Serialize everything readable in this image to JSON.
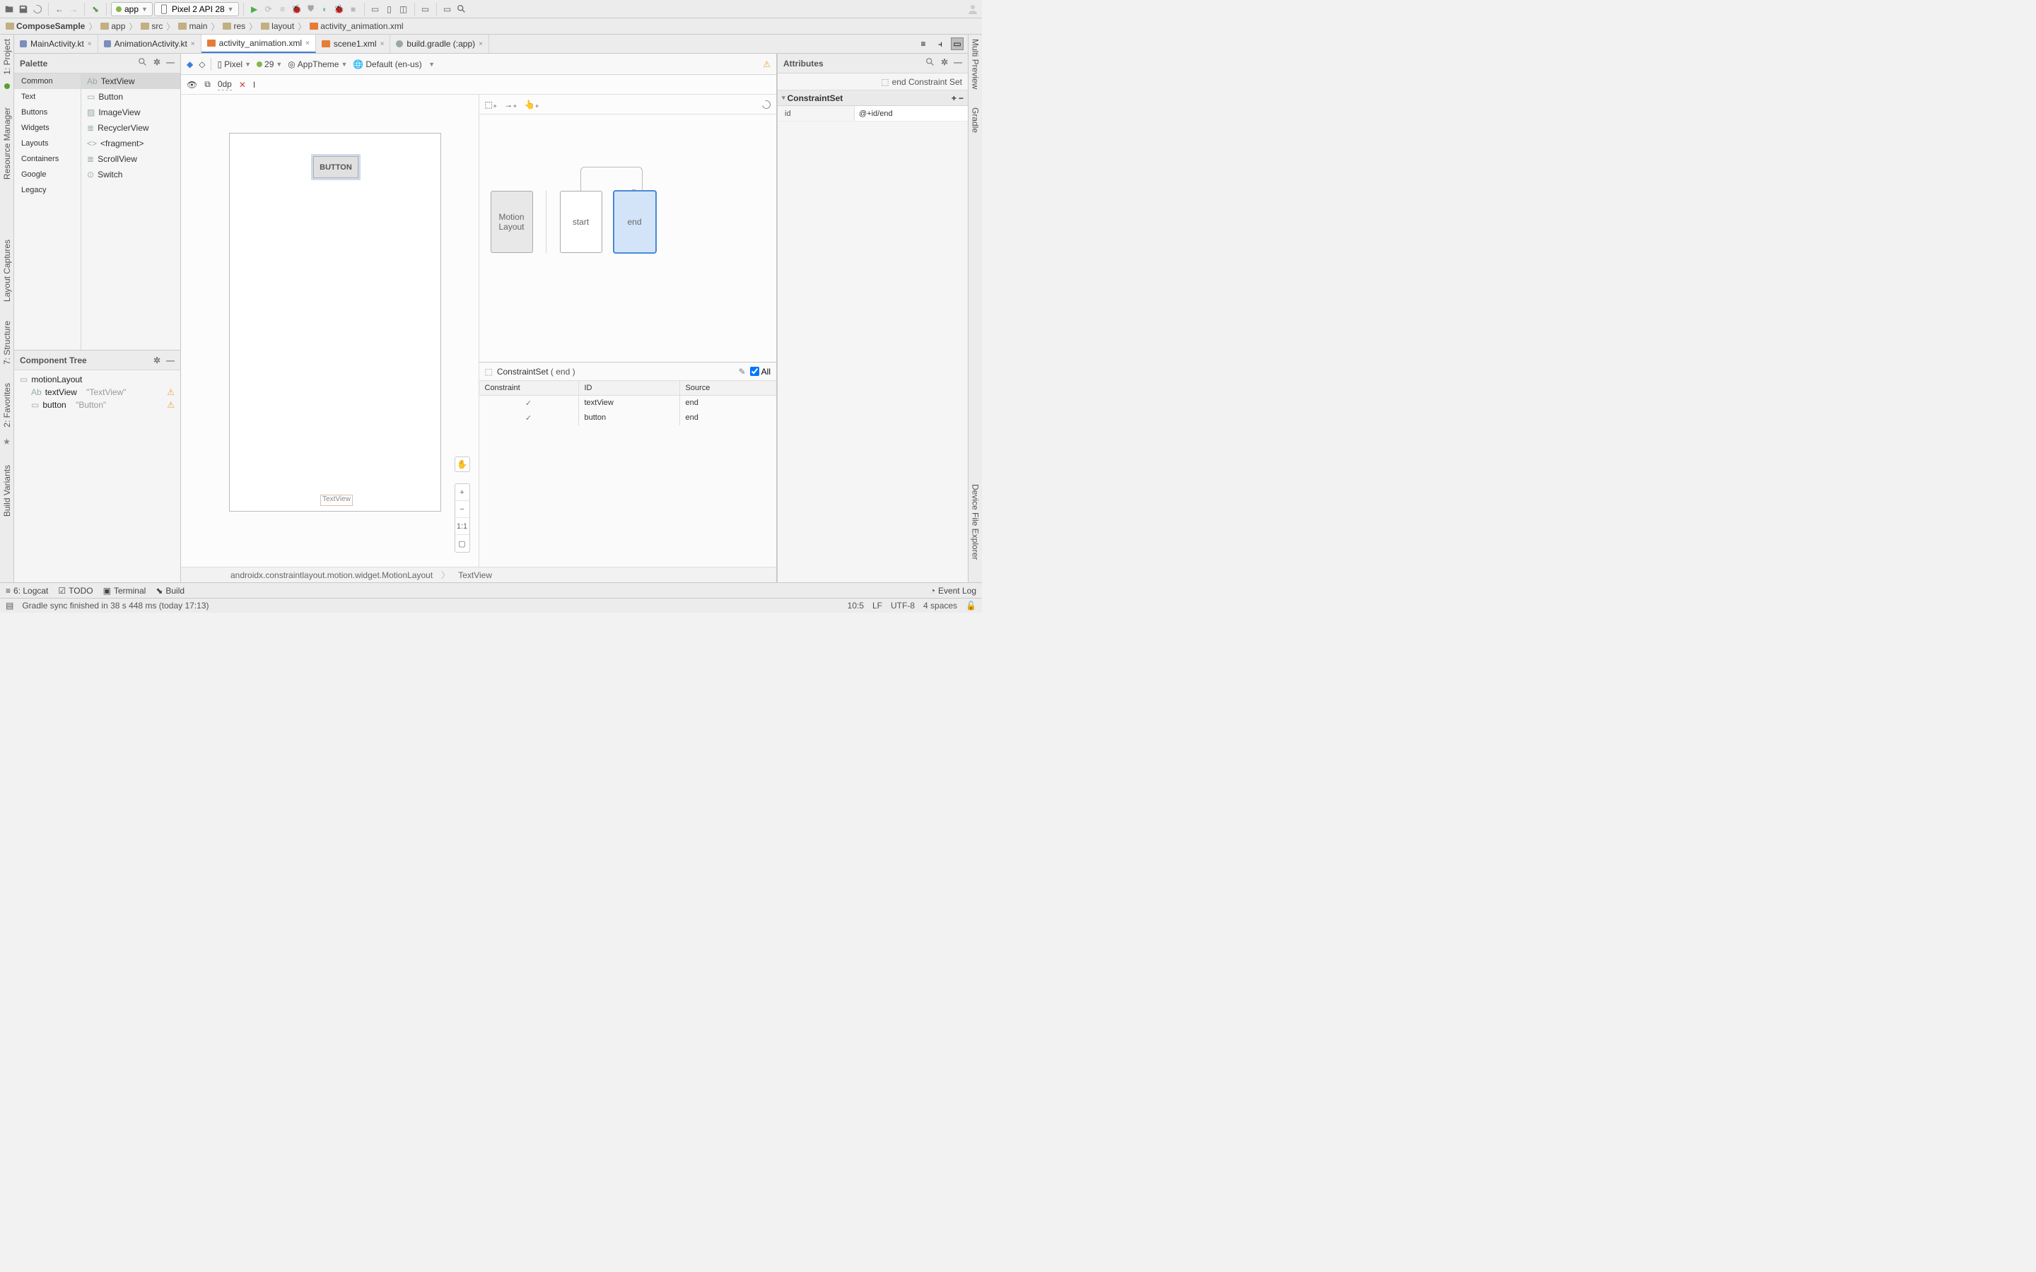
{
  "toolbar": {
    "module": "app",
    "device": "Pixel 2 API 28"
  },
  "breadcrumbs": [
    "ComposeSample",
    "app",
    "src",
    "main",
    "res",
    "layout",
    "activity_animation.xml"
  ],
  "tabs": [
    {
      "label": "MainActivity.kt",
      "type": "kt"
    },
    {
      "label": "AnimationActivity.kt",
      "type": "kt"
    },
    {
      "label": "activity_animation.xml",
      "type": "xml",
      "active": true
    },
    {
      "label": "scene1.xml",
      "type": "xml"
    },
    {
      "label": "build.gradle (:app)",
      "type": "gradle"
    }
  ],
  "palette": {
    "title": "Palette",
    "categories": [
      "Common",
      "Text",
      "Buttons",
      "Widgets",
      "Layouts",
      "Containers",
      "Google",
      "Legacy"
    ],
    "selectedCategory": "Common",
    "items": [
      "TextView",
      "Button",
      "ImageView",
      "RecyclerView",
      "<fragment>",
      "ScrollView",
      "Switch"
    ],
    "selectedItem": "TextView"
  },
  "componentTree": {
    "title": "Component Tree",
    "root": "motionLayout",
    "children": [
      {
        "name": "textView",
        "hint": "\"TextView\""
      },
      {
        "name": "button",
        "hint": "\"Button\""
      }
    ]
  },
  "canvasToolbar": {
    "device": "Pixel",
    "api": "29",
    "theme": "AppTheme",
    "locale": "Default (en-us)"
  },
  "subToolbar": {
    "margin": "0dp"
  },
  "designSurface": {
    "buttonLabel": "BUTTON",
    "textViewLabel": "TextView",
    "zoom11": "1:1"
  },
  "motionEditor": {
    "boxes": {
      "ml": "Motion\nLayout",
      "start": "start",
      "end": "end"
    }
  },
  "constraintSetPanel": {
    "title": "ConstraintSet",
    "subject": "( end )",
    "allLabel": "All",
    "cols": [
      "Constraint",
      "ID",
      "Source"
    ],
    "rows": [
      {
        "id": "textView",
        "src": "end"
      },
      {
        "id": "button",
        "src": "end"
      }
    ]
  },
  "attributes": {
    "title": "Attributes",
    "crumb": "end Constraint Set",
    "section": "ConstraintSet",
    "rows": [
      {
        "k": "id",
        "v": "@+id/end"
      }
    ]
  },
  "pathBar": [
    "androidx.constraintlayout.motion.widget.MotionLayout",
    "TextView"
  ],
  "toolWindows": {
    "logcat": "6: Logcat",
    "todo": "TODO",
    "terminal": "Terminal",
    "build": "Build",
    "eventLog": "Event Log"
  },
  "statusBar": {
    "msg": "Gradle sync finished in 38 s 448 ms (today 17:13)",
    "pos": "10:5",
    "eol": "LF",
    "enc": "UTF-8",
    "indent": "4 spaces"
  },
  "leftGutter": [
    "1: Project",
    "Resource Manager",
    "Layout Captures",
    "7: Structure",
    "2: Favorites",
    "Build Variants"
  ],
  "rightGutter": [
    "Multi Preview",
    "Gradle",
    "Device File Explorer"
  ]
}
